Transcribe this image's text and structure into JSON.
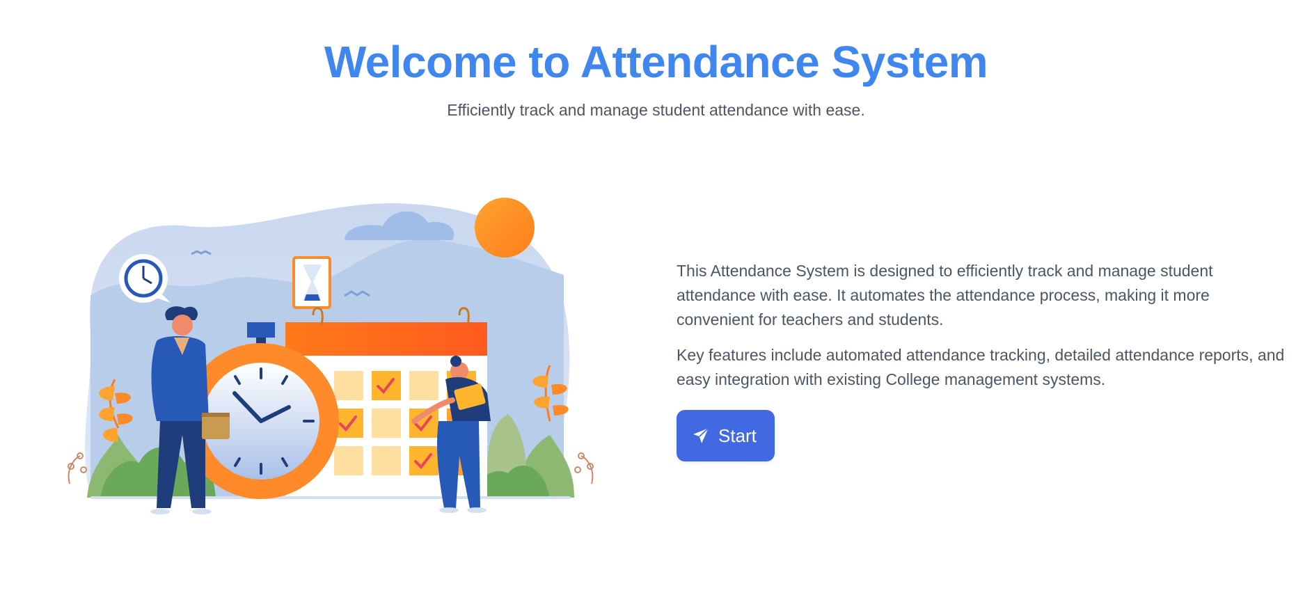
{
  "hero": {
    "title": "Welcome to Attendance System",
    "subtitle": "Efficiently track and manage student attendance with ease."
  },
  "illustration": {
    "icon": "attendance-illustration",
    "calendar_checked_cells": 6
  },
  "content": {
    "paragraph_1": "This Attendance System is designed to efficiently track and manage student attendance with ease. It automates the attendance process, making it more convenient for teachers and students.",
    "paragraph_2": "Key features include automated attendance tracking, detailed attendance reports, and easy integration with existing College management systems."
  },
  "start_button": {
    "label": "Start",
    "icon": "send-icon"
  },
  "colors": {
    "title": "#3f87ee",
    "subtitle": "#4b5563",
    "body_text": "#4b5563",
    "button_bg": "#4169e1",
    "button_text": "#ffffff"
  }
}
